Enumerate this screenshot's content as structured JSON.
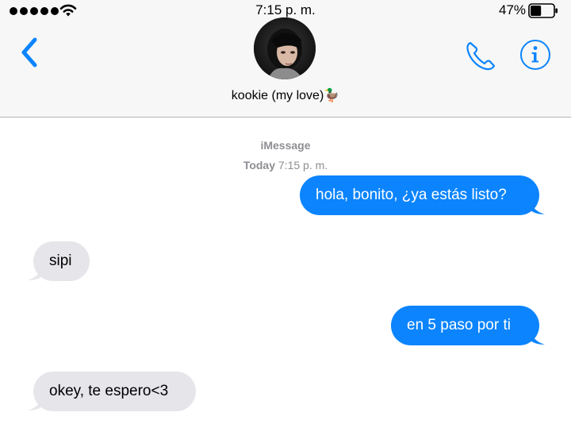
{
  "status_bar": {
    "time": "7:15 p. m.",
    "battery_percent": "47%",
    "battery_level": 0.47,
    "signal_icon": "signal-dots-icon",
    "wifi_icon": "wifi-icon",
    "battery_icon": "battery-icon"
  },
  "header": {
    "back_icon": "chevron-left-icon",
    "contact_name": "kookie (my love)🦆",
    "call_icon": "phone-icon",
    "info_icon": "info-icon"
  },
  "conversation": {
    "service": "iMessage",
    "timestamp_day": "Today",
    "timestamp_time": "7:15 p. m.",
    "messages": [
      {
        "direction": "outgoing",
        "text": "hola, bonito, ¿ya estás listo?"
      },
      {
        "direction": "incoming",
        "text": "sipi"
      },
      {
        "direction": "outgoing",
        "text": "en 5 paso por ti"
      },
      {
        "direction": "incoming",
        "text": "okey, te espero<3"
      }
    ]
  },
  "colors": {
    "accent": "#0b84fe",
    "incoming_bubble": "#e5e5ea",
    "secondary_text": "#8e8e93",
    "bar_background": "#f7f7f7"
  }
}
